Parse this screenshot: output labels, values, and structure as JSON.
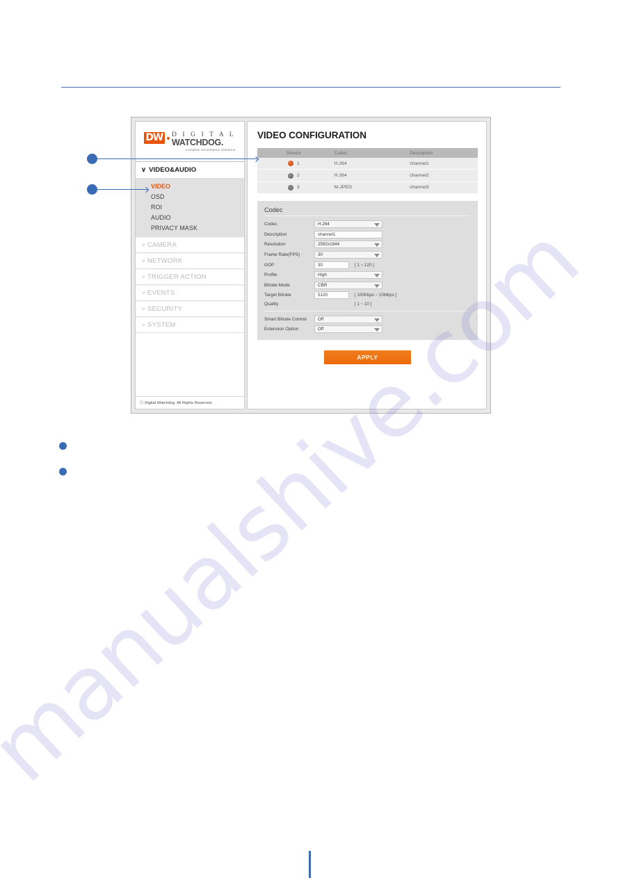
{
  "page": {
    "watermark": "manualshive.com"
  },
  "screenshot": {
    "nav": {
      "logo": {
        "mark": "DW",
        "line1": "D I G I T A L",
        "line2": "WATCHDOG.",
        "tagline": "Complete Surveillance Solutions"
      },
      "expanded_group": {
        "chevron": "∨",
        "label": "VIDEO&AUDIO",
        "items": [
          {
            "label": "VIDEO",
            "active": true
          },
          {
            "label": "OSD",
            "active": false
          },
          {
            "label": "ROI",
            "active": false
          },
          {
            "label": "AUDIO",
            "active": false
          },
          {
            "label": "PRIVACY MASK",
            "active": false
          }
        ]
      },
      "groups": [
        {
          "chevron": ">",
          "label": "CAMERA"
        },
        {
          "chevron": ">",
          "label": "NETWORK"
        },
        {
          "chevron": ">",
          "label": "TRIGGER ACTION"
        },
        {
          "chevron": ">",
          "label": "EVENTS"
        },
        {
          "chevron": ">",
          "label": "SECURITY"
        },
        {
          "chevron": ">",
          "label": "SYSTEM"
        }
      ],
      "footer": "ⓒ Digital Watchdog. All Rights Reserved."
    },
    "content": {
      "title": "VIDEO CONFIGURATION",
      "stream_table": {
        "headers": [
          "Stream",
          "Codec",
          "Description"
        ],
        "rows": [
          {
            "stream": "1",
            "codec": "H.264",
            "description": "channel1",
            "active": true
          },
          {
            "stream": "2",
            "codec": "H.264",
            "description": "channel2",
            "active": false
          },
          {
            "stream": "3",
            "codec": "M-JPEG",
            "description": "channel3",
            "active": false
          }
        ]
      },
      "codec": {
        "section_title": "Codec",
        "fields": {
          "codec_label": "Codec",
          "codec_value": "H.264",
          "description_label": "Description",
          "description_value": "channel1",
          "resolution_label": "Resolution",
          "resolution_value": "2592x1944",
          "framerate_label": "Frame Rate(FPS)",
          "framerate_value": "30",
          "gop_label": "GOP",
          "gop_value": "30",
          "gop_hint": "[ 1 ~ 120 ]",
          "profile_label": "Profile",
          "profile_value": "High",
          "bitrate_mode_label": "Bitrate Mode",
          "bitrate_mode_value": "CBR",
          "target_bitrate_label": "Target Bitrate",
          "target_bitrate_value": "5120",
          "target_bitrate_hint": "[ 100Kbps ~ 10Mbps ]",
          "quality_label": "Quality",
          "quality_hint": "[ 1 ~ 10 ]",
          "smart_bitrate_label": "Smart Bitrate Control",
          "smart_bitrate_value": "Off",
          "extension_option_label": "Extension Option",
          "extension_option_value": "Off"
        }
      },
      "apply_label": "APPLY"
    }
  },
  "colors": {
    "accent_orange": "#E8540B",
    "callout_blue": "#3a6cb5",
    "rule_blue": "#4a72ab",
    "apply_button": "#ec6a0a"
  }
}
